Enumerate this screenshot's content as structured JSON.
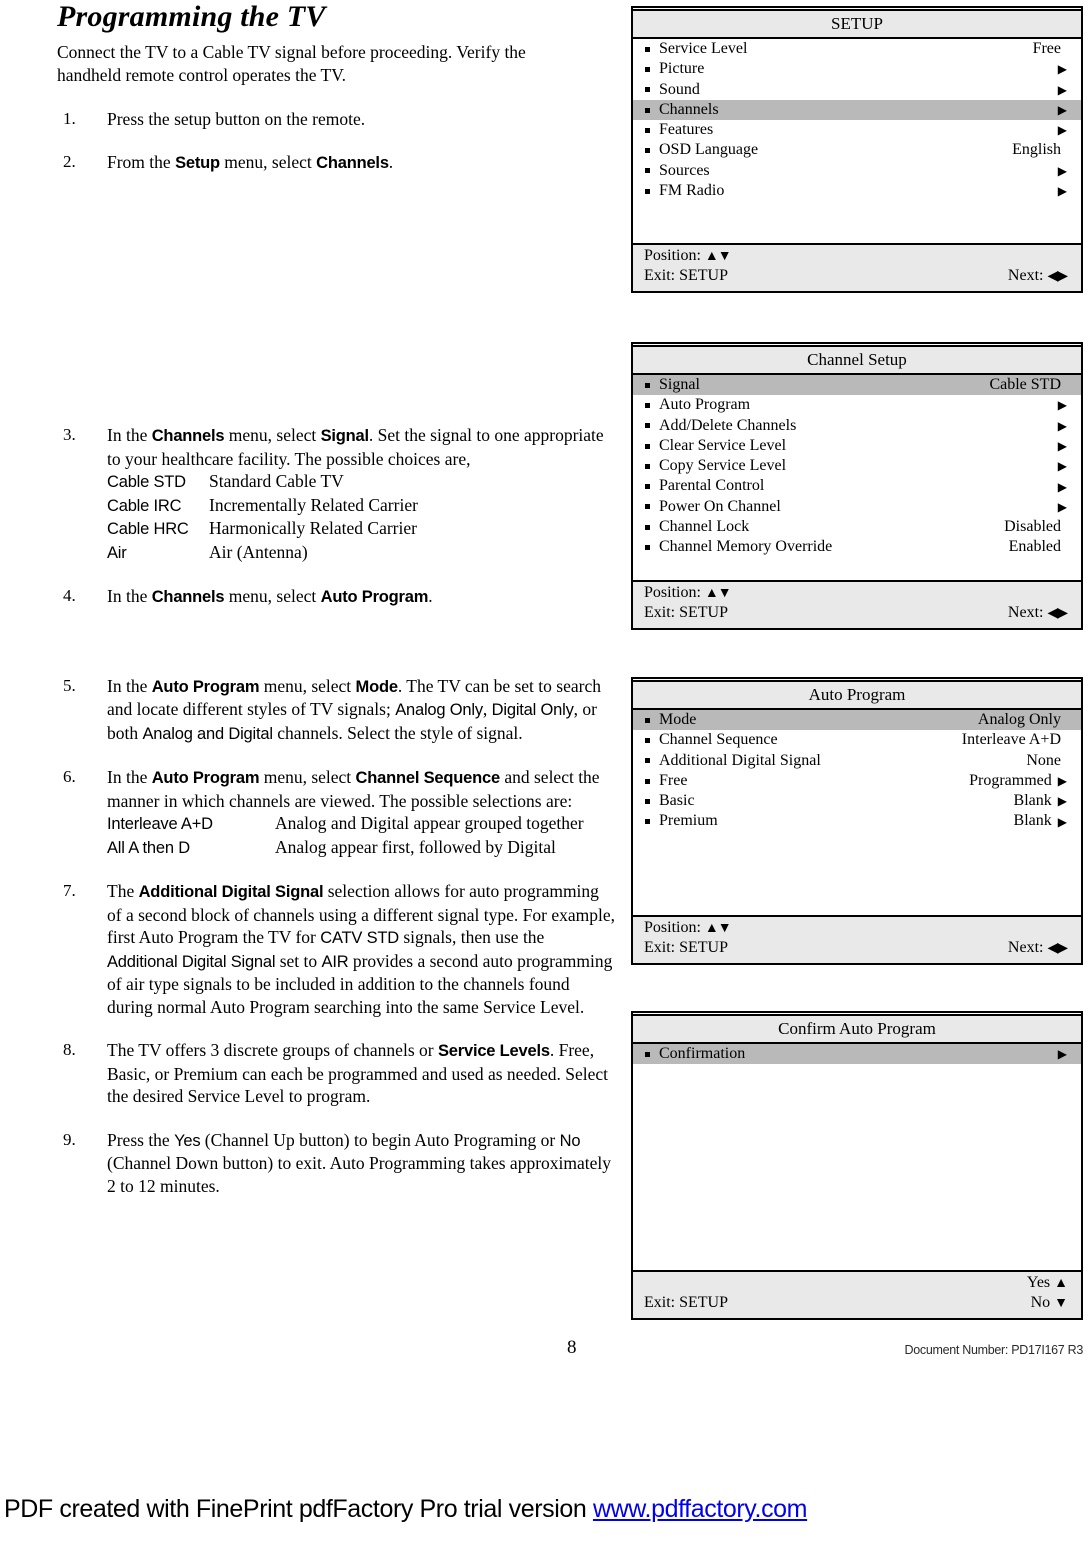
{
  "document": {
    "heading": "Programming the TV",
    "intro": "Connect the TV to a Cable TV signal before proceeding.  Verify the handheld remote control operates the TV.",
    "page_number": "8",
    "document_number": "Document Number: PD17I167 R3"
  },
  "steps": [
    {
      "num": "1.",
      "text": "Press the setup button on the remote."
    },
    {
      "num": "2.",
      "text": "From the Setup menu, select Channels."
    },
    {
      "num": "3.",
      "text": "In the Channels menu, select Signal.  Set the signal to one appropriate to your healthcare facility.  The possible choices are,"
    },
    {
      "num": "4.",
      "text": "In the Channels menu, select Auto Program."
    },
    {
      "num": "5.",
      "text": "In the Auto Program menu, select Mode.  The TV can be set to search and locate different styles of TV signals; Analog Only, Digital Only, or both Analog and Digital channels.  Select the style of signal."
    },
    {
      "num": "6.",
      "text": "In the Auto Program menu, select Channel Sequence and select the manner in which channels are viewed.  The possible selections are:"
    },
    {
      "num": "7.",
      "text": "The Additional Digital Signal selection allows for auto programming of a second block of channels using a different signal type.  For example, first Auto Program the TV for CATV STD signals, then use the Additional Digital Signal set to AIR provides a second auto programming of air type signals to be included in addition to the channels found during normal Auto Program searching into the same Service Level."
    },
    {
      "num": "8.",
      "text": "The TV offers 3 discrete groups of channels or Service Levels. Free, Basic, or Premium can each be programmed and used as needed.  Select the desired Service Level to program."
    },
    {
      "num": "9.",
      "text": "Press the Yes (Channel Up button) to begin Auto Programing or No (Channel Down button) to exit.   Auto Programming takes approximately 2 to 12 minutes."
    }
  ],
  "step2_fragments": {
    "a": "From the ",
    "setup": "Setup",
    "b": " menu, select ",
    "channels": "Channels",
    "c": "."
  },
  "step3_fragments": {
    "a": "In the ",
    "channels": "Channels",
    "b": " menu, select ",
    "signal": "Signal",
    "c": ".  Set the signal to one appropriate to your healthcare facility.  The possible choices are,"
  },
  "signal_choices": [
    {
      "term": "Cable STD",
      "desc": "Standard Cable TV"
    },
    {
      "term": "Cable IRC",
      "desc": "Incrementally Related Carrier"
    },
    {
      "term": "Cable HRC",
      "desc": "Harmonically Related Carrier"
    },
    {
      "term": "Air",
      "desc": "Air (Antenna)"
    }
  ],
  "step4_fragments": {
    "a": "In the ",
    "channels": "Channels",
    "b": " menu, select ",
    "auto_program": "Auto Program",
    "c": "."
  },
  "step5_fragments": {
    "a": "In the ",
    "auto_program": "Auto Program",
    "b": " menu, select ",
    "mode": "Mode",
    "c": ".  The TV can be set to search and locate different styles of TV signals; ",
    "analog_only": "Analog Only",
    "d": ", ",
    "digital_only": "Digital Only",
    "e": ", or both ",
    "analog_and_digital": "Analog and Digital",
    "f": " channels.  Select the style of signal."
  },
  "step6_fragments": {
    "a": "In the ",
    "auto_program": "Auto Program",
    "b": " menu, select ",
    "channel_sequence": "Channel Sequence",
    "c": " and select the manner in which channels are viewed.  The possible selections are:"
  },
  "sequence_choices": [
    {
      "term": "Interleave A+D",
      "desc": "Analog and Digital appear grouped together"
    },
    {
      "term": "All A then D",
      "desc": "Analog appear first, followed by Digital"
    }
  ],
  "step7_fragments": {
    "a": "The ",
    "additional_digital_signal": "Additional Digital Signal",
    "b": " selection allows for auto programming of a second block of channels using a different signal type.  For example, first Auto Program the TV for ",
    "catv_std": "CATV STD",
    "c": " signals, then use the ",
    "additional_digital_signal2": "Additional Digital Signal",
    "d": " set to ",
    "air": "AIR",
    "e": " provides a second auto programming of air type signals to be included in addition to the channels found during normal Auto Program searching into the same Service Level."
  },
  "step8_fragments": {
    "a": "The TV offers 3 discrete groups of channels or ",
    "service_levels": "Service Levels",
    "b": ". Free, Basic, or Premium can each be programmed and used as needed.  Select the desired Service Level to program."
  },
  "step9_fragments": {
    "a": "Press the ",
    "yes": "Yes",
    "b": " (Channel Up button) to begin Auto Programing or ",
    "no": "No",
    "c": " (Channel Down button) to exit.   Auto Programming takes approximately 2 to 12 minutes."
  },
  "menus": [
    {
      "title": "SETUP",
      "rows": [
        {
          "label": "Service Level",
          "value": "Free",
          "arrow": "",
          "selected": false
        },
        {
          "label": "Picture",
          "value": "",
          "arrow": "▶",
          "selected": false
        },
        {
          "label": "Sound",
          "value": "",
          "arrow": "▶",
          "selected": false
        },
        {
          "label": "Channels",
          "value": "",
          "arrow": "▶",
          "selected": true
        },
        {
          "label": "Features",
          "value": "",
          "arrow": "▶",
          "selected": false
        },
        {
          "label": "OSD Language",
          "value": "English",
          "arrow": "",
          "selected": false
        },
        {
          "label": "Sources",
          "value": "",
          "arrow": "▶",
          "selected": false
        },
        {
          "label": "FM Radio",
          "value": "",
          "arrow": "▶",
          "selected": false
        }
      ],
      "footer": {
        "position_label": "Position:",
        "position_arrows": "▲▼",
        "exit_label": "Exit: SETUP",
        "next_label": "Next:",
        "next_arrows": "◀▶"
      }
    },
    {
      "title": "Channel Setup",
      "rows": [
        {
          "label": "Signal",
          "value": "Cable STD",
          "arrow": "",
          "selected": true
        },
        {
          "label": "Auto Program",
          "value": "",
          "arrow": "▶",
          "selected": false
        },
        {
          "label": "Add/Delete Channels",
          "value": "",
          "arrow": "▶",
          "selected": false
        },
        {
          "label": "Clear Service Level",
          "value": "",
          "arrow": "▶",
          "selected": false
        },
        {
          "label": "Copy Service Level",
          "value": "",
          "arrow": "▶",
          "selected": false
        },
        {
          "label": "Parental Control",
          "value": "",
          "arrow": "▶",
          "selected": false
        },
        {
          "label": "Power On Channel",
          "value": "",
          "arrow": "▶",
          "selected": false
        },
        {
          "label": "Channel Lock",
          "value": "Disabled",
          "arrow": "",
          "selected": false
        },
        {
          "label": "Channel Memory Override",
          "value": "Enabled",
          "arrow": "",
          "selected": false
        }
      ],
      "footer": {
        "position_label": "Position:",
        "position_arrows": "▲▼",
        "exit_label": "Exit: SETUP",
        "next_label": "Next:",
        "next_arrows": "◀▶"
      }
    },
    {
      "title": "Auto Program",
      "rows": [
        {
          "label": "Mode",
          "value": "Analog Only",
          "arrow": "",
          "selected": true
        },
        {
          "label": "Channel Sequence",
          "value": "Interleave A+D",
          "arrow": "",
          "selected": false
        },
        {
          "label": "Additional Digital Signal",
          "value": "None",
          "arrow": "",
          "selected": false
        },
        {
          "label": "Free",
          "value": "Programmed",
          "arrow": "▶",
          "selected": false
        },
        {
          "label": "Basic",
          "value": "Blank",
          "arrow": "▶",
          "selected": false
        },
        {
          "label": "Premium",
          "value": "Blank",
          "arrow": "▶",
          "selected": false
        }
      ],
      "footer": {
        "position_label": "Position:",
        "position_arrows": "▲▼",
        "exit_label": "Exit: SETUP",
        "next_label": "Next:",
        "next_arrows": "◀▶"
      }
    },
    {
      "title": "Confirm Auto Program",
      "rows": [
        {
          "label": "Confirmation",
          "value": "",
          "arrow": "▶",
          "selected": true
        }
      ],
      "footer": {
        "exit_label": "Exit: SETUP",
        "yes_label": "Yes",
        "yes_arrow": "▲",
        "no_label": "No",
        "no_arrow": "▼"
      }
    }
  ],
  "pdf_banner": {
    "text": "PDF created with FinePrint pdfFactory Pro trial version ",
    "link": "www.pdffactory.com"
  }
}
